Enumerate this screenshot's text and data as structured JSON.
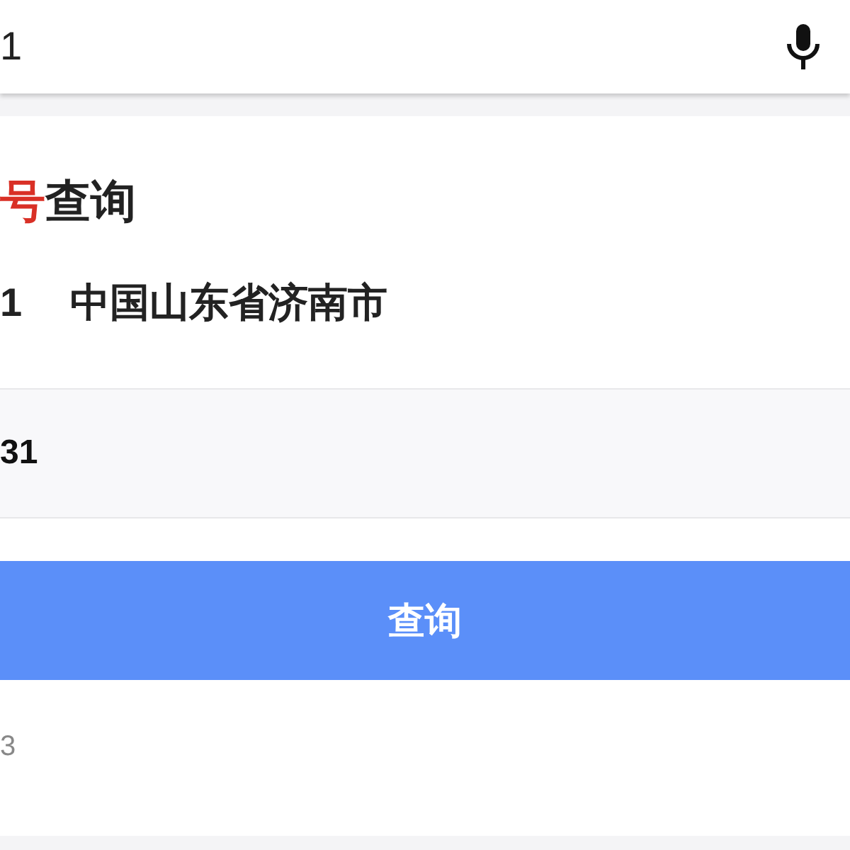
{
  "search": {
    "value": "1"
  },
  "card": {
    "title": [
      {
        "text": "号",
        "color": "#d93026"
      },
      {
        "text": "查询",
        "color": "#222222"
      }
    ],
    "result": {
      "number": "1",
      "location": "中国山东省济南市"
    },
    "input": {
      "value": "31"
    },
    "submit": "查询",
    "footer": "3"
  }
}
